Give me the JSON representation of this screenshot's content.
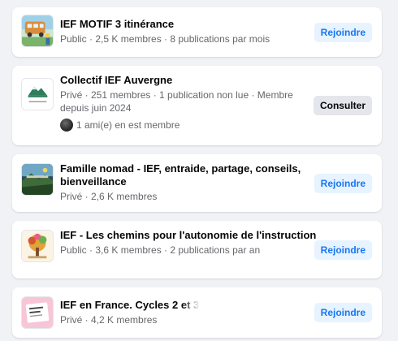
{
  "groups": [
    {
      "name": "IEF MOTIF 3 itinérance",
      "meta": "Public · 2,5 K membres · 8 publications par mois",
      "button": "Rejoindre",
      "thumb_icon": "bus-travel-image"
    },
    {
      "name": "Collectif IEF Auvergne",
      "meta": "Privé · 251 membres · 1 publication non lue · Membre depuis juin 2024",
      "friends": "1 ami(e) en est membre",
      "button": "Consulter",
      "thumb_icon": "mountain-logo-image",
      "thumb_text": "COLLECTIF IEF"
    },
    {
      "name": "Famille nomad - IEF, entraide, partage, conseils, bienveillance",
      "meta": "Privé · 2,6 K membres",
      "button": "Rejoindre",
      "thumb_icon": "nomad-family-image"
    },
    {
      "name": "IEF - Les chemins pour l'autonomie de l'instruction",
      "meta": "Public · 3,6 K membres · 2 publications par an",
      "button": "Rejoindre",
      "thumb_icon": "tree-illustration-image"
    },
    {
      "name": "IEF en France. Cycles 2 et 3",
      "meta": "Privé · 4,2 K membres",
      "button": "Rejoindre",
      "thumb_icon": "notebook-image"
    }
  ],
  "colors": {
    "background": "#f0f2f5",
    "card": "#ffffff",
    "primary": "#1877f2",
    "join_bg": "#e7f3ff",
    "secondary_bg": "#e4e6eb",
    "meta_text": "#65676b"
  }
}
